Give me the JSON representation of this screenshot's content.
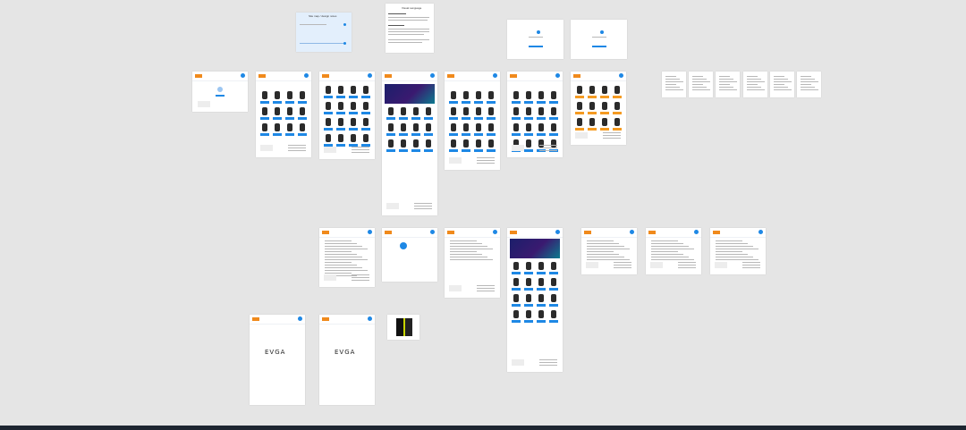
{
  "canvas": {
    "title": "",
    "note_top_label": "Site map / design notes",
    "doc_title": "Visual Language",
    "brand_logo_text": "EVGA",
    "brand_logo_text_2": "EVGA"
  },
  "colors": {
    "canvas_bg": "#e5e5e5",
    "accent_blue": "#1e88e5",
    "accent_orange": "#f59b22",
    "hero_gradient": [
      "#1b1f6b",
      "#3a1a70",
      "#0c7a8e"
    ],
    "bottom_bar": "#1d2530"
  },
  "frames": [
    {
      "name": "frame-note-blue"
    },
    {
      "name": "frame-doc-visual-language"
    },
    {
      "name": "frame-login-1"
    },
    {
      "name": "frame-login-2"
    },
    {
      "name": "frame-account"
    },
    {
      "name": "frame-laptops"
    },
    {
      "name": "frame-graphics"
    },
    {
      "name": "frame-home"
    },
    {
      "name": "frame-pc-builds"
    },
    {
      "name": "frame-mixed"
    },
    {
      "name": "frame-peripherals"
    },
    {
      "name": "frame-small-1"
    },
    {
      "name": "frame-small-2"
    },
    {
      "name": "frame-small-3"
    },
    {
      "name": "frame-small-4"
    },
    {
      "name": "frame-small-5"
    },
    {
      "name": "frame-small-6"
    },
    {
      "name": "frame-article"
    },
    {
      "name": "frame-confirm"
    },
    {
      "name": "frame-form"
    },
    {
      "name": "frame-home-2"
    },
    {
      "name": "frame-list-1"
    },
    {
      "name": "frame-list-2"
    },
    {
      "name": "frame-list-3"
    },
    {
      "name": "frame-evga-1"
    },
    {
      "name": "frame-evga-2"
    },
    {
      "name": "frame-gpu-thumb"
    }
  ]
}
